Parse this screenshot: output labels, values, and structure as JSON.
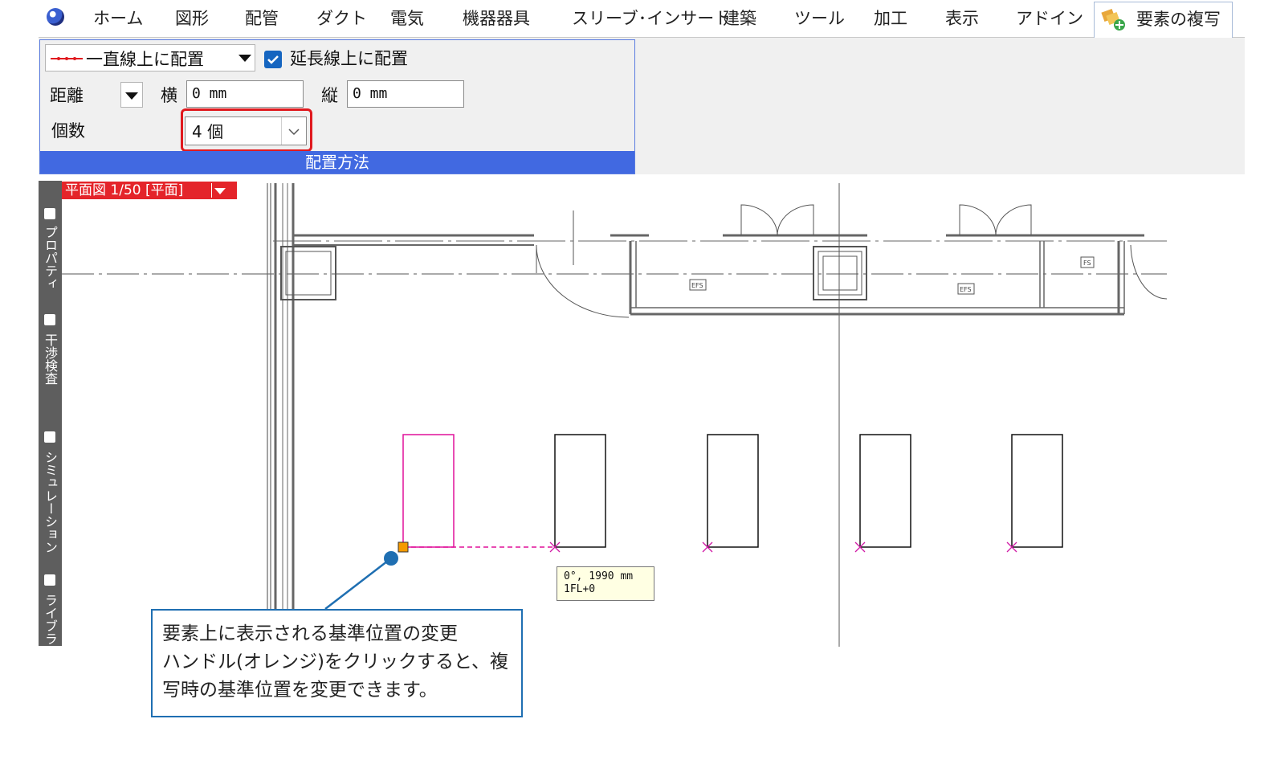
{
  "ribbon": {
    "tabs": [
      "ホーム",
      "図形",
      "配管",
      "ダクト",
      "電気",
      "機器器具",
      "スリーブ･インサート",
      "建築",
      "ツール",
      "加工",
      "表示",
      "アドイン"
    ],
    "active_tab": "要素の複写"
  },
  "panel": {
    "placement_method": "一直線上に配置",
    "extend_line_label": "延長線上に配置",
    "extend_line_checked": true,
    "distance_label": "距離",
    "horizontal_label": "横",
    "horizontal_value": "0 mm",
    "vertical_label": "縦",
    "vertical_value": "0 mm",
    "count_label": "個数",
    "count_value": "4 個",
    "group_title": "配置方法"
  },
  "dock": {
    "items": [
      "プロパティ",
      "干渉検査",
      "シミュレーション",
      "ライブラ"
    ]
  },
  "view": {
    "tag": "平面図 1/50 [平面]",
    "symbol_efs": "EFS",
    "symbol_fs": "FS"
  },
  "tooltip": {
    "line1": "0°, 1990 mm",
    "line2": "1FL+0"
  },
  "callout": {
    "line1": "要素上に表示される基準位置の変更",
    "line2": "ハンドル(オレンジ)をクリックすると、複",
    "line3": "写時の基準位置を変更できます。"
  },
  "colors": {
    "accent_blue": "#4169e1",
    "highlight_red": "#e0191e",
    "selected_magenta": "#e0109a",
    "handle_orange": "#f59a00",
    "callout_blue": "#1f6fb2"
  }
}
